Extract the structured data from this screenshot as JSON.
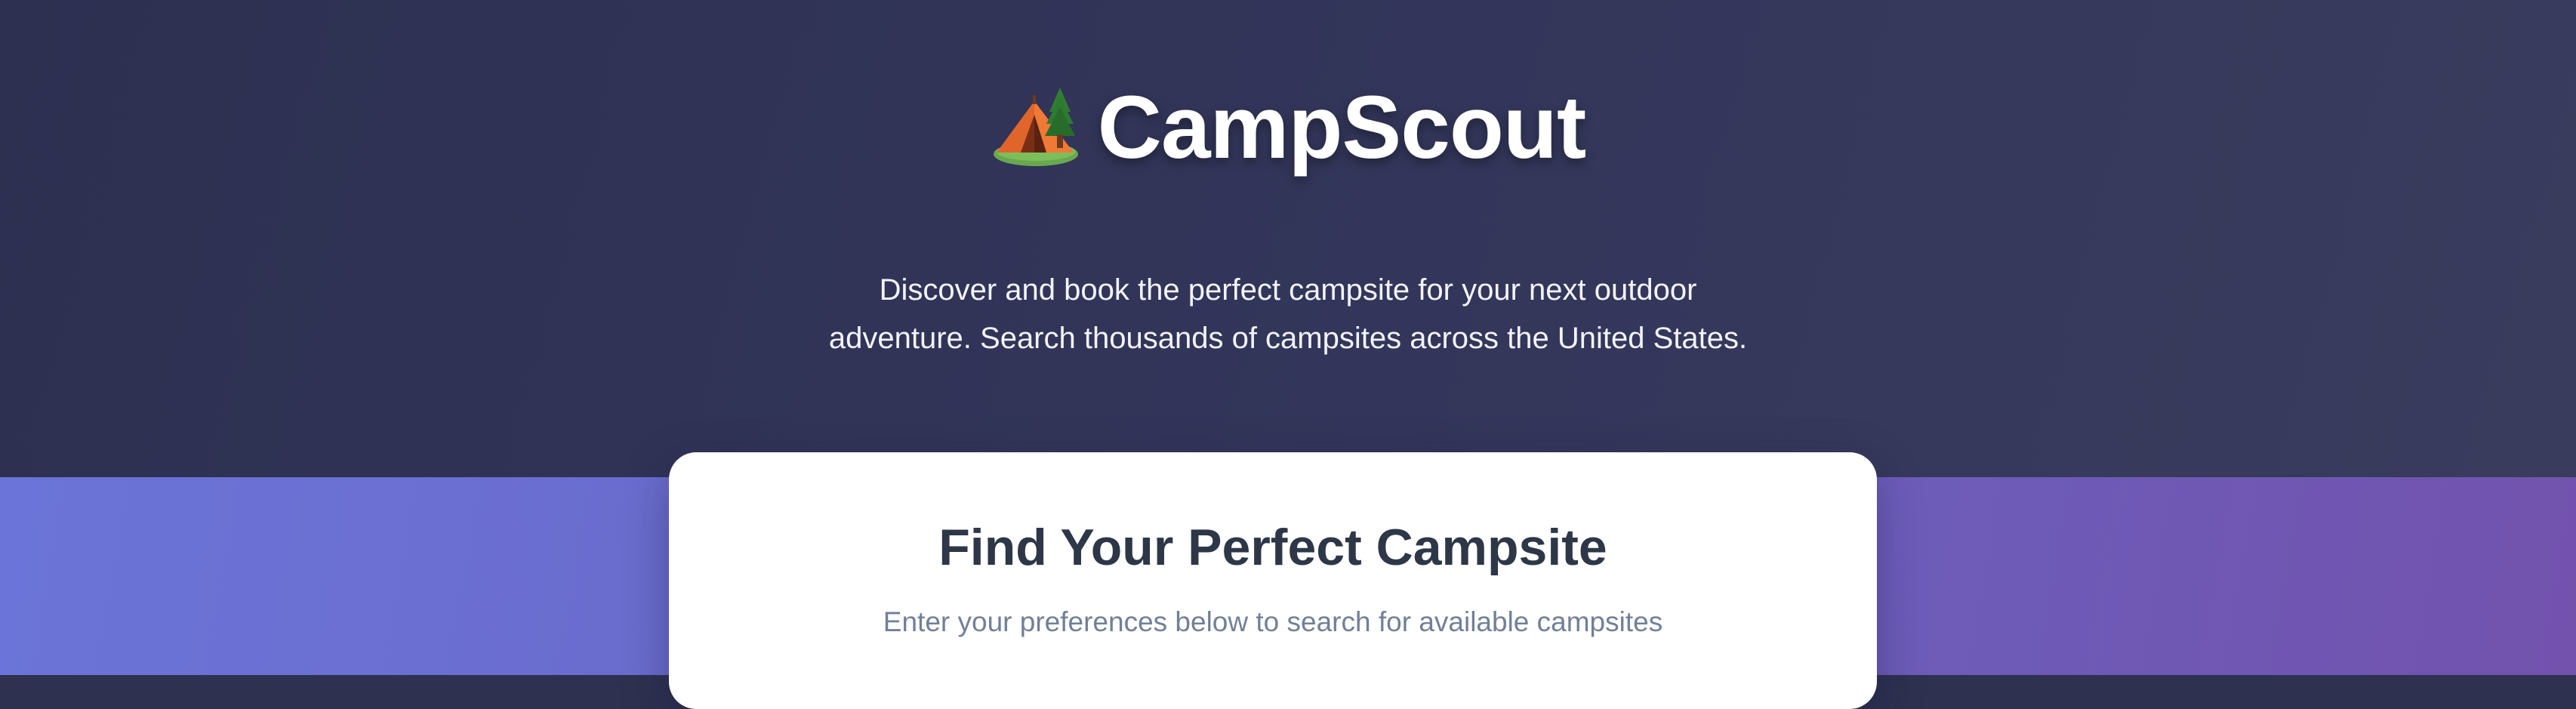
{
  "hero": {
    "logo_icon": "camping-tent-emoji",
    "brand_name": "CampScout",
    "tagline": "Discover and book the perfect campsite for your next outdoor adventure. Search thousands of campsites across the United States."
  },
  "search_card": {
    "title": "Find Your Perfect Campsite",
    "subtitle": "Enter your preferences below to search for available campsites"
  },
  "colors": {
    "hero_bg": "#2e3150",
    "page_gradient_start": "#6b74d8",
    "page_gradient_end": "#7252ad",
    "card_bg": "#ffffff",
    "card_title": "#2d3748",
    "card_subtitle": "#718096"
  }
}
